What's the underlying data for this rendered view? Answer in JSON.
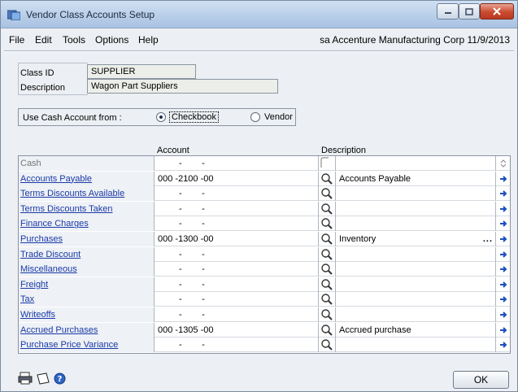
{
  "window": {
    "title": "Vendor Class Accounts Setup"
  },
  "menu": {
    "items": [
      "File",
      "Edit",
      "Tools",
      "Options",
      "Help"
    ],
    "right_info": "sa  Accenture Manufacturing Corp  11/9/2013"
  },
  "form": {
    "class_id_label": "Class ID",
    "class_id_value": "SUPPLIER",
    "description_label": "Description",
    "description_value": "Wagon Part Suppliers",
    "cash_account_label": "Use Cash Account from :",
    "radio_options": [
      {
        "label": "Checkbook",
        "selected": true
      },
      {
        "label": "Vendor",
        "selected": false
      }
    ]
  },
  "grid": {
    "headers": {
      "account": "Account",
      "description": "Description"
    },
    "rows": [
      {
        "label": "Cash",
        "link": false,
        "account": "-        -",
        "description": ""
      },
      {
        "label": "Accounts Payable",
        "link": true,
        "account": "000 -2100 -00",
        "description": "Accounts Payable"
      },
      {
        "label": "Terms Discounts Available",
        "link": true,
        "account": "-        -",
        "description": ""
      },
      {
        "label": "Terms Discounts Taken",
        "link": true,
        "account": "-        -",
        "description": ""
      },
      {
        "label": "Finance Charges",
        "link": true,
        "account": "-        -",
        "description": ""
      },
      {
        "label": "Purchases",
        "link": true,
        "account": "000 -1300 -00",
        "description": "Inventory",
        "ellipsis": "..."
      },
      {
        "label": "Trade Discount",
        "link": true,
        "account": "-        -",
        "description": ""
      },
      {
        "label": "Miscellaneous",
        "link": true,
        "account": "-        -",
        "description": ""
      },
      {
        "label": "Freight",
        "link": true,
        "account": "-        -",
        "description": ""
      },
      {
        "label": "Tax",
        "link": true,
        "account": "-        -",
        "description": ""
      },
      {
        "label": "Writeoffs",
        "link": true,
        "account": "-        -",
        "description": ""
      },
      {
        "label": "Accrued Purchases",
        "link": true,
        "account": "000 -1305 -00",
        "description": "Accrued purchase"
      },
      {
        "label": "Purchase Price Variance",
        "link": true,
        "account": "-        -",
        "description": ""
      }
    ]
  },
  "footer": {
    "ok_label": "OK"
  },
  "colors": {
    "link": "#1a3aa8",
    "arrow": "#1d4fbf",
    "window_bg": "#eceff3"
  }
}
